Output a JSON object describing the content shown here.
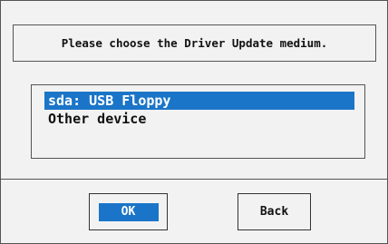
{
  "dialog": {
    "title": "Please choose the Driver Update medium.",
    "options": [
      {
        "label": "sda: USB Floppy",
        "selected": true
      },
      {
        "label": "Other device",
        "selected": false
      }
    ],
    "buttons": {
      "ok_label": "OK",
      "back_label": "Back"
    },
    "colors": {
      "selection": "#1a75c8",
      "background": "#f2f2f2",
      "border": "#555555"
    }
  }
}
